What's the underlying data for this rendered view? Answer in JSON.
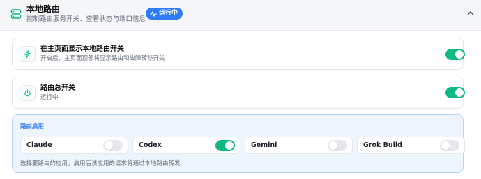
{
  "header": {
    "title": "本地路由",
    "subtitle": "控制路由服务开关、查看状态与端口信息",
    "status_badge": "运行中",
    "icon": "server-icon",
    "collapse_icon": "chevron-up-icon"
  },
  "settings": [
    {
      "title": "在主页面显示本地路由开关",
      "subtitle": "开启后，主页面顶部将显示路由和故障转移开关",
      "icon": "lightning-icon",
      "enabled": true
    },
    {
      "title": "路由总开关",
      "subtitle": "运行中",
      "icon": "power-icon",
      "enabled": true
    }
  ],
  "routing": {
    "title": "路由启用",
    "apps": [
      {
        "label": "Claude",
        "enabled": false
      },
      {
        "label": "Codex",
        "enabled": true
      },
      {
        "label": "Gemini",
        "enabled": false
      },
      {
        "label": "Grok Build",
        "enabled": false
      }
    ],
    "note": "选择要路由的应用，启用后该应用的请求将通过本地路由转发"
  },
  "colors": {
    "accent_green": "#10b981",
    "badge_blue": "#2f7bf5",
    "routing_bg": "#eef5fe"
  }
}
